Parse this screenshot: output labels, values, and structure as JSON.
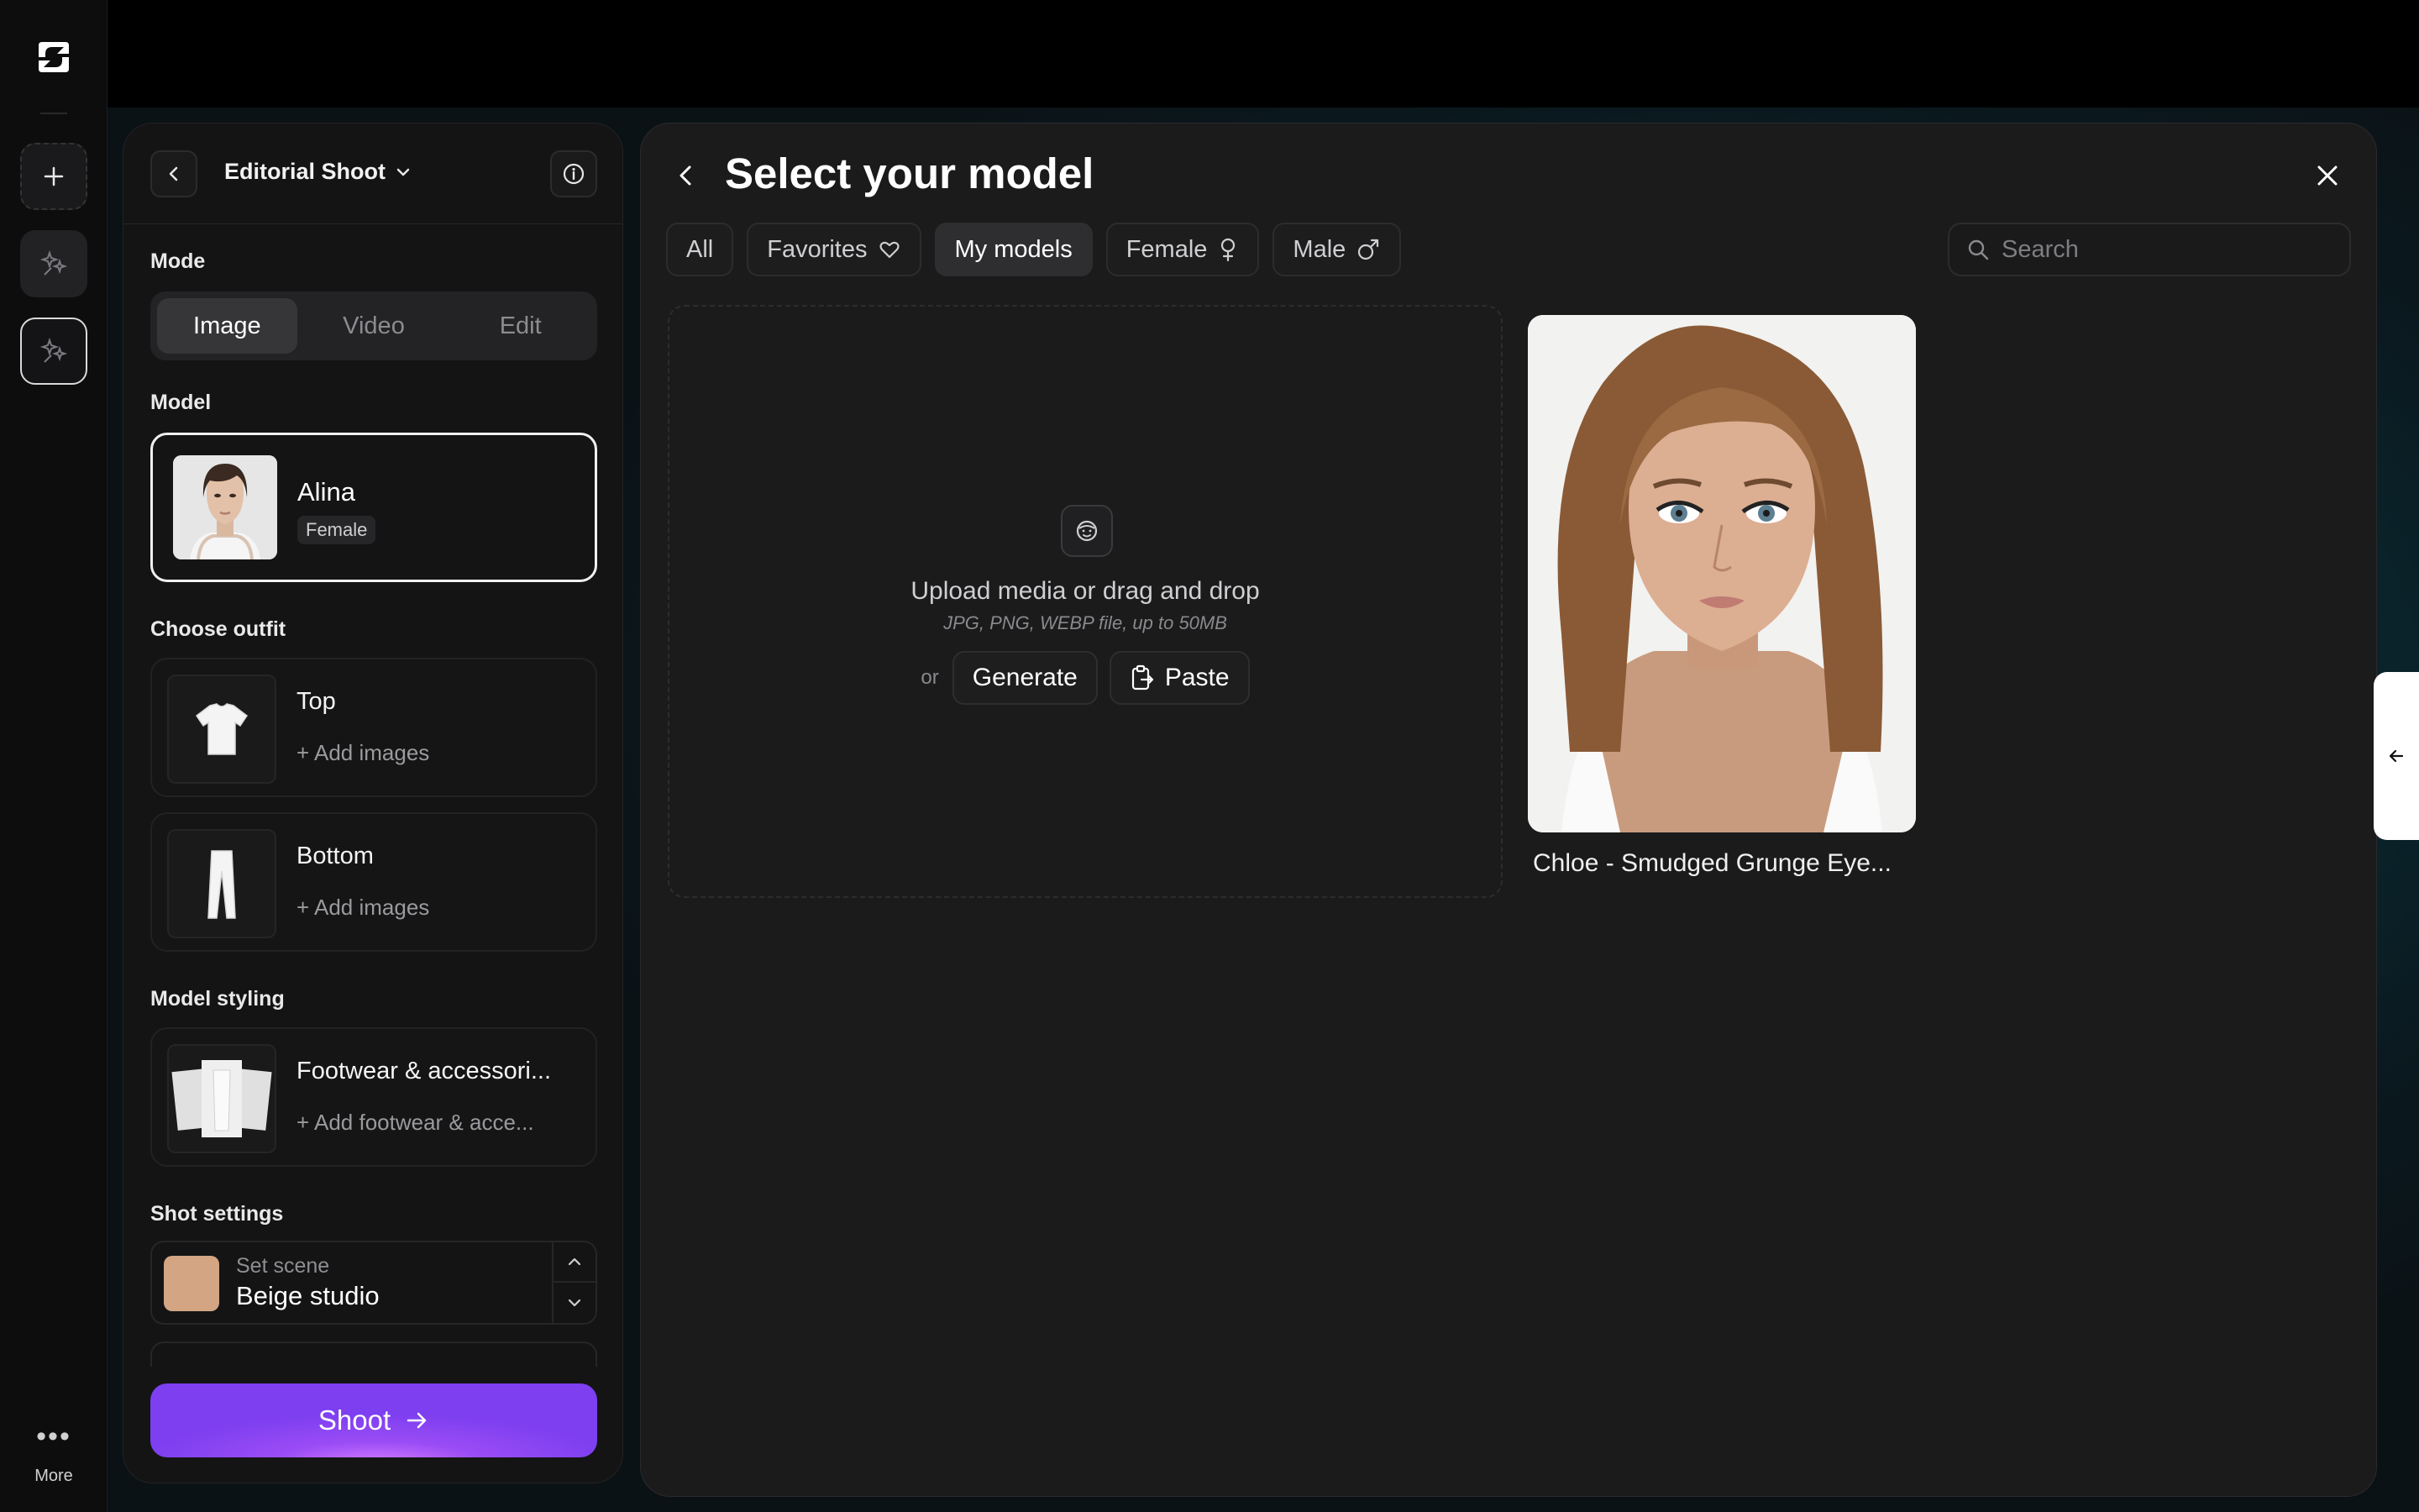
{
  "sidebar": {
    "more_label": "More",
    "buttons": [
      "new-icon",
      "sparkle-magic-icon",
      "sparkle-magic-active-icon"
    ]
  },
  "project": {
    "title": "Editorial Shoot"
  },
  "mode": {
    "label": "Mode",
    "options": [
      "Image",
      "Video",
      "Edit"
    ],
    "selected": "Image"
  },
  "model": {
    "label": "Model",
    "name": "Alina",
    "gender": "Female"
  },
  "outfit": {
    "label": "Choose outfit",
    "items": [
      {
        "title": "Top",
        "action": "Add images"
      },
      {
        "title": "Bottom",
        "action": "Add images"
      }
    ]
  },
  "styling": {
    "label": "Model styling",
    "title": "Footwear & accessori...",
    "action": "Add footwear & acce..."
  },
  "shot": {
    "label": "Shot settings",
    "scene_label": "Set scene",
    "scene_value": "Beige studio",
    "scene_color": "#d3a583"
  },
  "shoot_button": "Shoot",
  "selector": {
    "title": "Select your model",
    "filters": [
      {
        "label": "All",
        "icon": ""
      },
      {
        "label": "Favorites",
        "icon": "heart-icon"
      },
      {
        "label": "My models",
        "icon": ""
      },
      {
        "label": "Female",
        "icon": "female-icon"
      },
      {
        "label": "Male",
        "icon": "male-icon"
      }
    ],
    "selected_filter": "My models",
    "search_placeholder": "Search",
    "upload": {
      "title": "Upload media or drag and drop",
      "subtitle": "JPG, PNG, WEBP file, up to 50MB",
      "or": "or",
      "generate": "Generate",
      "paste": "Paste"
    },
    "models": [
      {
        "name": "Chloe - Smudged Grunge Eye..."
      }
    ]
  },
  "colors": {
    "accent": "#8b45f4",
    "background": "#0c0c0d",
    "panel": "#141415"
  }
}
